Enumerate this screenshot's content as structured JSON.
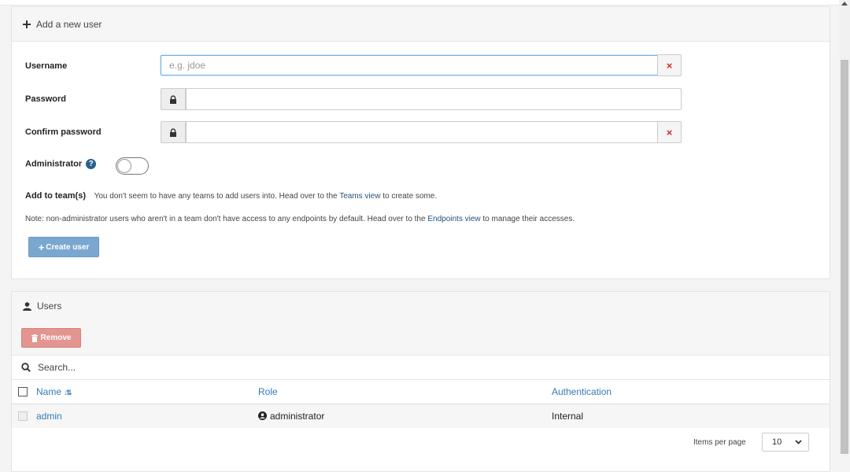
{
  "add_user": {
    "header": "Add a new user",
    "username_label": "Username",
    "username_placeholder": "e.g. jdoe",
    "username_value": "",
    "password_label": "Password",
    "confirm_label": "Confirm password",
    "clear_glyph": "×",
    "admin_label": "Administrator",
    "admin_help_glyph": "?",
    "team_label": "Add to team(s)",
    "team_msg_before": "You don't seem to have any teams to add users into. Head over to the",
    "team_link": "Teams view",
    "team_msg_after": "to create some.",
    "note_before": "Note: non-administrator users who aren't in a team don't have access to any endpoints by default. Head over to the",
    "note_link": "Endpoints view",
    "note_after": "to manage their accesses.",
    "create_button": "Create user",
    "create_glyph": "+"
  },
  "users": {
    "header": "Users",
    "remove_button": "Remove",
    "search_placeholder": "Search...",
    "columns": {
      "name": "Name",
      "name_sort_glyph": "↓⇅",
      "role": "Role",
      "auth": "Authentication"
    },
    "rows": [
      {
        "name": "admin",
        "role": "administrator",
        "auth": "Internal"
      }
    ],
    "items_per_page_label": "Items per page",
    "items_per_page_value": "10"
  },
  "colors": {
    "link": "#337ab7",
    "primary_button": "#7aa7d0",
    "danger_button": "#e39591",
    "clear_x": "#c9302c"
  }
}
